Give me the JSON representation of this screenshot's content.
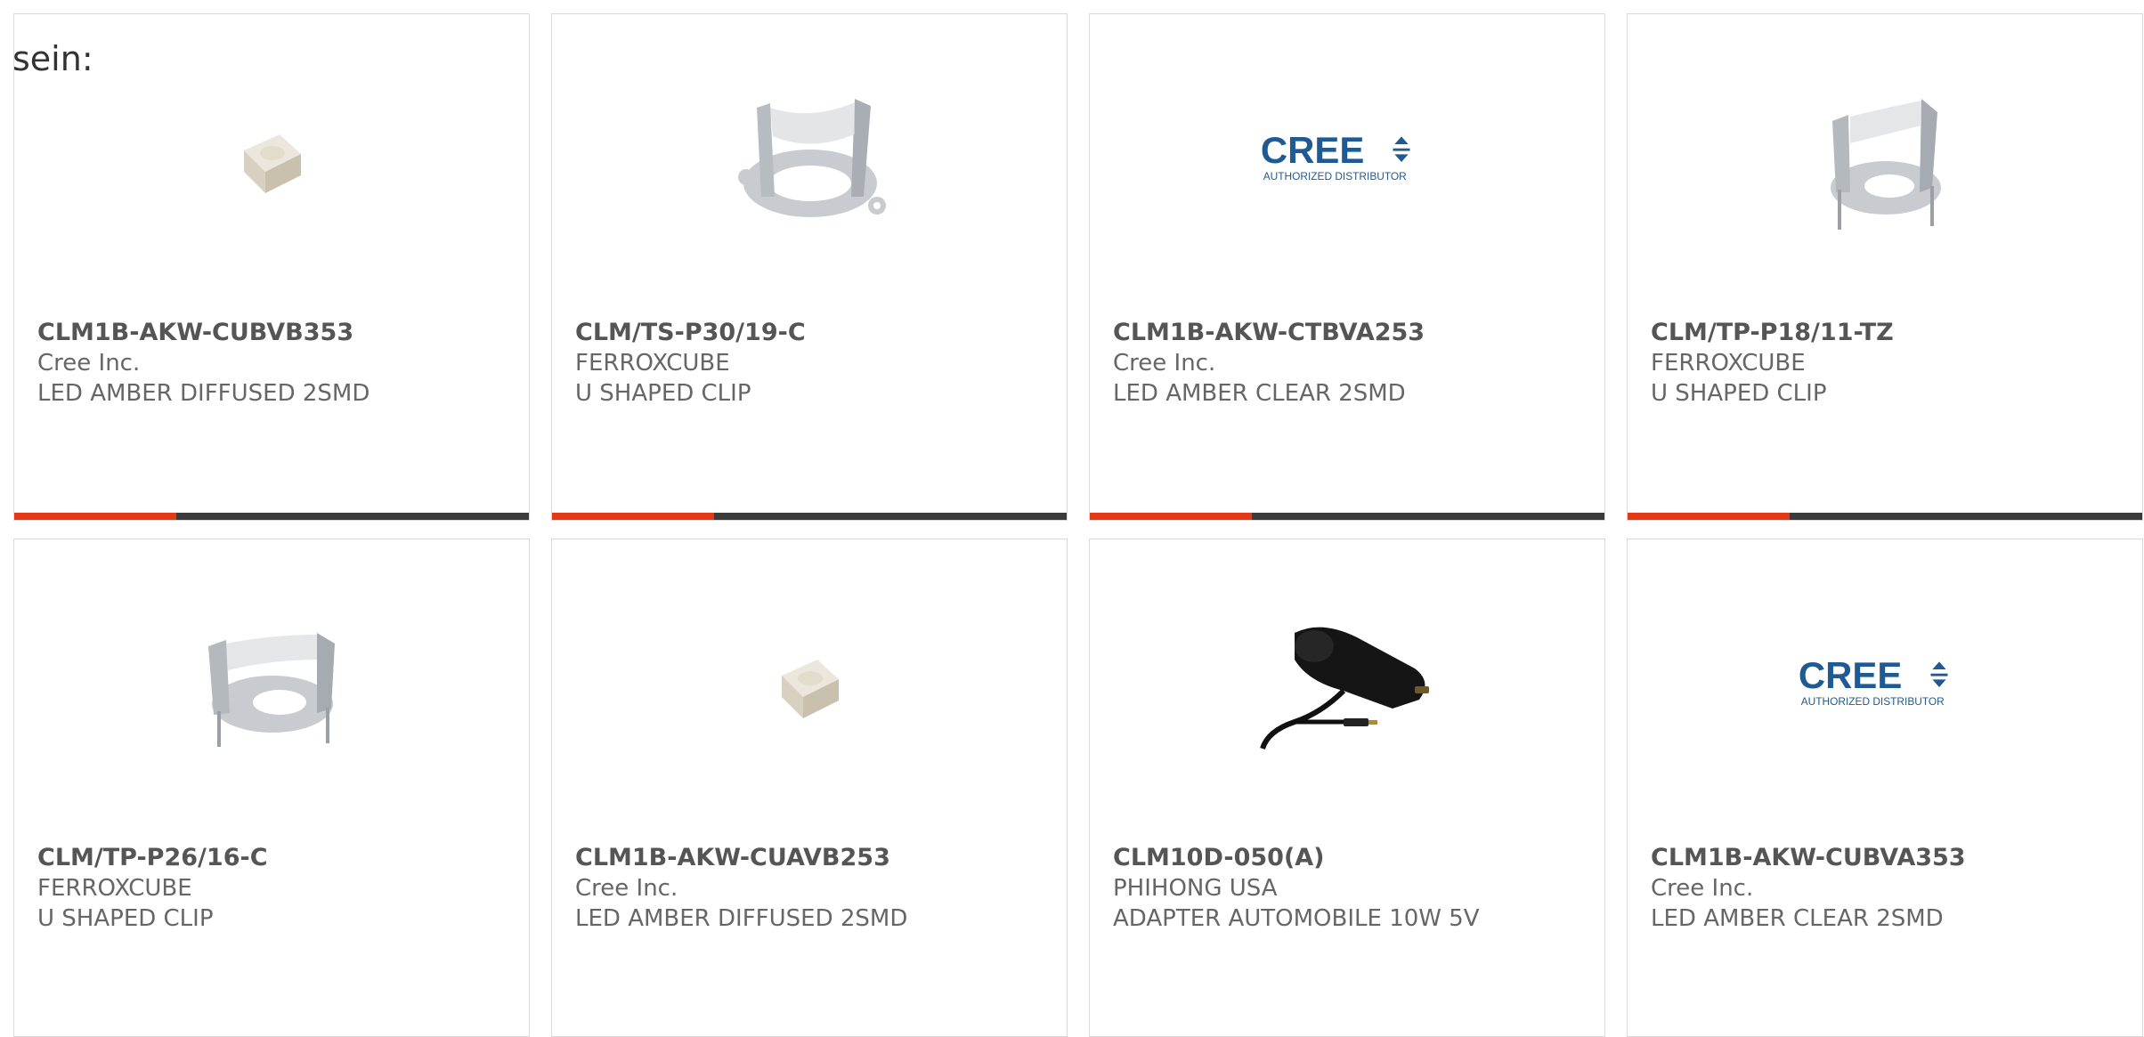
{
  "intro_text": "sein:",
  "colors": {
    "accent": "#e23a14",
    "bar_track": "#3b3b3b",
    "cree_blue": "#1f5a93"
  },
  "products": [
    {
      "part_number": "CLM1B-AKW-CUBVB353",
      "manufacturer": "Cree Inc.",
      "description": "LED AMBER DIFFUSED 2SMD",
      "image": "led-chip-icon"
    },
    {
      "part_number": "CLM/TS-P30/19-C",
      "manufacturer": "FERROXCUBE",
      "description": "U SHAPED CLIP",
      "image": "clip-icon"
    },
    {
      "part_number": "CLM1B-AKW-CTBVA253",
      "manufacturer": "Cree Inc.",
      "description": "LED AMBER CLEAR 2SMD",
      "image": "cree-logo"
    },
    {
      "part_number": "CLM/TP-P18/11-TZ",
      "manufacturer": "FERROXCUBE",
      "description": "U SHAPED CLIP",
      "image": "clip-icon"
    },
    {
      "part_number": "CLM/TP-P26/16-C",
      "manufacturer": "FERROXCUBE",
      "description": "U SHAPED CLIP",
      "image": "clip-icon"
    },
    {
      "part_number": "CLM1B-AKW-CUAVB253",
      "manufacturer": "Cree Inc.",
      "description": "LED AMBER DIFFUSED 2SMD",
      "image": "led-chip-icon"
    },
    {
      "part_number": "CLM10D-050(A)",
      "manufacturer": "PHIHONG USA",
      "description": "ADAPTER AUTOMOBILE 10W 5V",
      "image": "car-adapter-icon"
    },
    {
      "part_number": "CLM1B-AKW-CUBVA353",
      "manufacturer": "Cree Inc.",
      "description": "LED AMBER CLEAR 2SMD",
      "image": "cree-logo"
    }
  ],
  "cree_logo": {
    "wordmark": "CREE",
    "tagline": "AUTHORIZED DISTRIBUTOR"
  }
}
